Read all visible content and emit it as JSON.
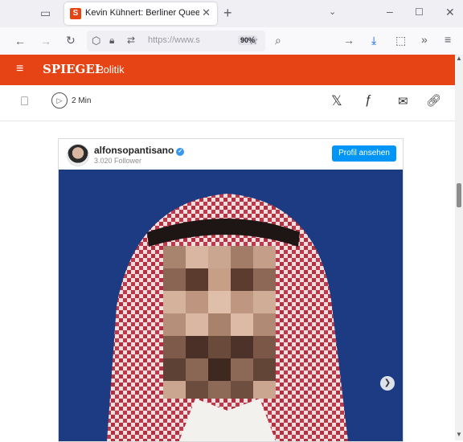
{
  "browser": {
    "tab": {
      "favicon_letter": "S",
      "title": "Kevin Kühnert: Berliner Queer-B"
    },
    "url": "https://www.s",
    "zoom": "90%"
  },
  "site": {
    "brand": "SPIEGEL",
    "section": "Politik",
    "accent": "#e64415"
  },
  "article_tools": {
    "listen_label": "2 Min"
  },
  "embed": {
    "username": "alfonsopantisano",
    "verified": "✓",
    "followers": "3.020 Follower",
    "profile_button": "Profil ansehen",
    "photo_description": "pixelated"
  }
}
